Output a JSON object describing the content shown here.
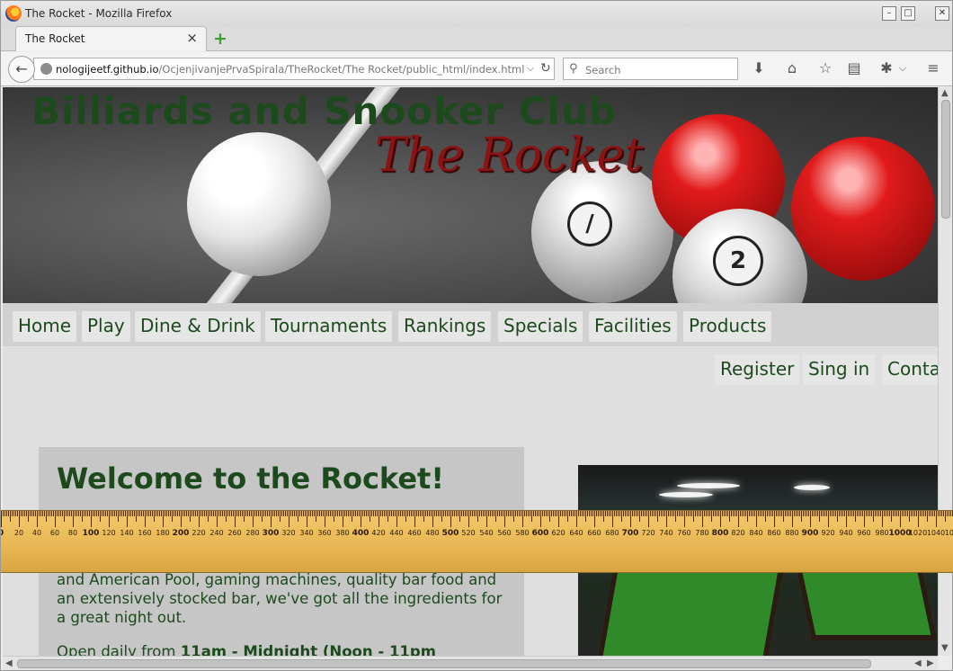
{
  "window": {
    "title": "The Rocket - Mozilla Firefox",
    "tab_label": "The Rocket",
    "url_host": "nologijeetf.github.io",
    "url_path": "/OcjenjivanjePrvaSpirala/TheRocket/The Rocket/public_html/index.html",
    "search_placeholder": "Search"
  },
  "site": {
    "title": "Billiards and Snooker Club",
    "subtitle": "The Rocket"
  },
  "menu": {
    "items": [
      "Home",
      "Play",
      "Dine & Drink",
      "Tournaments",
      "Rankings",
      "Specials",
      "Facilities",
      "Products"
    ]
  },
  "user_menu": {
    "items": [
      "Register",
      "Sing in",
      "Conta"
    ]
  },
  "welcome": {
    "title": "Welcome to the Rocket!",
    "text": "and American Pool, gaming machines, quality bar food and an extensively stocked bar, we've got all the ingredients for a great night out.",
    "hours_prefix": "Open daily from ",
    "hours_bold": "11am - Midnight (Noon - 11pm"
  },
  "ruler": {
    "labels": [
      "0",
      "20",
      "40",
      "60",
      "80",
      "100",
      "120",
      "140",
      "160",
      "180",
      "200",
      "220",
      "240",
      "260",
      "280",
      "300",
      "320",
      "340",
      "360",
      "380",
      "400",
      "420",
      "440",
      "460",
      "480",
      "500",
      "520",
      "540",
      "560",
      "580",
      "600",
      "620",
      "640",
      "660",
      "680",
      "700",
      "720",
      "740",
      "760",
      "780",
      "800",
      "820",
      "840",
      "860",
      "880",
      "900",
      "920",
      "940",
      "960",
      "980",
      "1000",
      "1020",
      "1040",
      "1060"
    ]
  },
  "icons": [
    "firefox-logo-icon",
    "minimize-icon",
    "maximize-icon",
    "close-icon",
    "new-tab-icon",
    "back-icon",
    "globe-icon",
    "dropdown-icon",
    "reload-icon",
    "search-icon",
    "download-icon",
    "home-icon",
    "bookmark-star-icon",
    "reading-list-icon",
    "extension-icon",
    "menu-icon"
  ]
}
